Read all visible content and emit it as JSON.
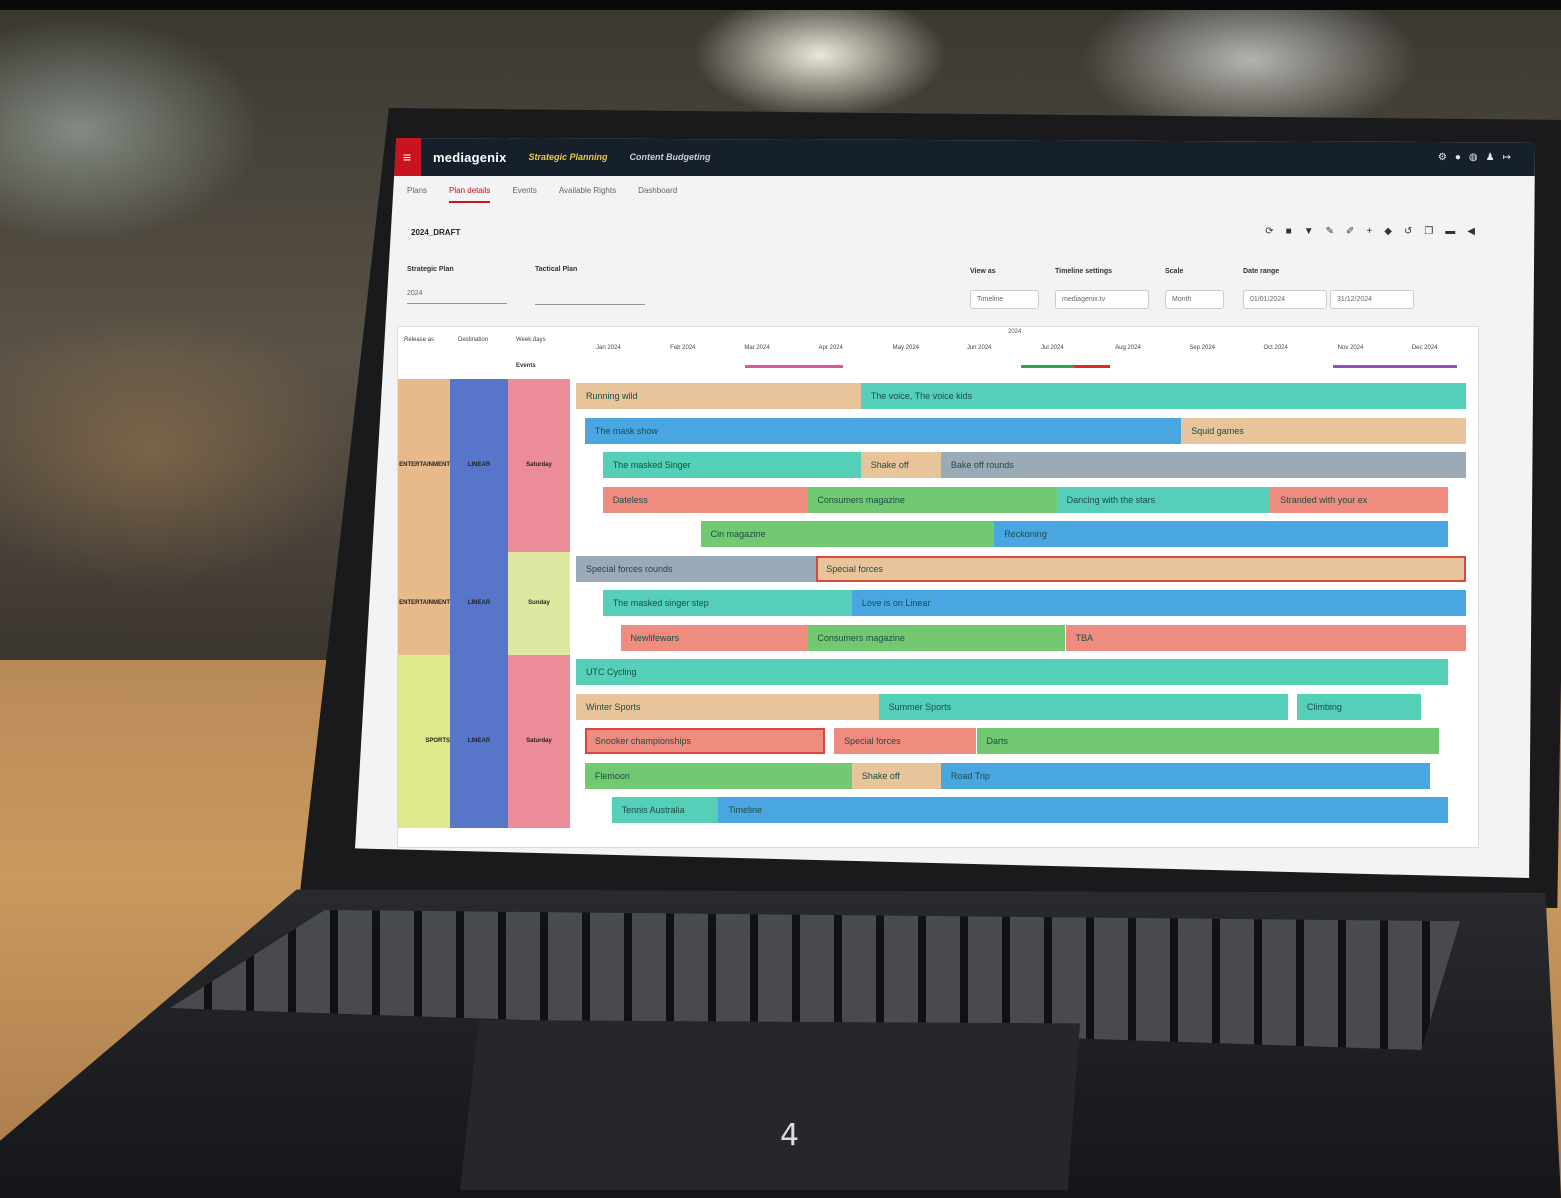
{
  "app": {
    "brand": "mediagenix",
    "nav": [
      "Strategic Planning",
      "Content Budgeting"
    ],
    "active_nav": 0
  },
  "subtabs": [
    "Plans",
    "Plan details",
    "Events",
    "Available Rights",
    "Dashboard"
  ],
  "active_subtab": 1,
  "plan_title": "2024_DRAFT",
  "filters": {
    "strategic_plan_label": "Strategic Plan",
    "strategic_plan_value": "2024",
    "tactical_plan_label": "Tactical Plan",
    "tactical_plan_value": "",
    "view_as_label": "View as",
    "view_as_value": "Timeline",
    "timeline_settings_label": "Timeline settings",
    "timeline_settings_value": "mediagenix.tv",
    "scale_label": "Scale",
    "scale_value": "Month",
    "date_range_label": "Date range",
    "date_from": "01/01/2024",
    "date_to": "31/12/2024"
  },
  "gantt": {
    "columns": [
      "Release as",
      "Destination",
      "Week days"
    ],
    "events_label": "Events",
    "year": "2024",
    "months": [
      "Jan 2024",
      "Feb 2024",
      "Mar 2024",
      "Apr 2024",
      "May 2024",
      "Jun 2024",
      "Jul 2024",
      "Aug 2024",
      "Sep 2024",
      "Oct 2024",
      "Nov 2024",
      "Dec 2024"
    ],
    "groups": [
      {
        "category": "ENTERTAINMENT",
        "destination": "LINEAR",
        "days": "Saturday",
        "rows": 5
      },
      {
        "category": "ENTERTAINMENT",
        "destination": "LINEAR",
        "days": "Sunday",
        "rows": 3
      },
      {
        "category": "SPORTS",
        "destination": "LINEAR",
        "days": "Saturday",
        "rows": 5
      }
    ],
    "bars": [
      {
        "row": 0,
        "label": "Running wild",
        "start": 0.0,
        "end": 0.32,
        "color": "#e8c49a"
      },
      {
        "row": 0,
        "label": "The voice, The voice kids",
        "start": 0.32,
        "end": 1.0,
        "color": "#56cfb8"
      },
      {
        "row": 1,
        "label": "The mask show",
        "start": 0.01,
        "end": 0.68,
        "color": "#4aa6e0"
      },
      {
        "row": 1,
        "label": "Squid games",
        "start": 0.68,
        "end": 1.0,
        "color": "#e8c49a"
      },
      {
        "row": 2,
        "label": "The masked Singer",
        "start": 0.03,
        "end": 0.32,
        "color": "#56cfb8"
      },
      {
        "row": 2,
        "label": "Shake off",
        "start": 0.32,
        "end": 0.41,
        "color": "#e8c49a"
      },
      {
        "row": 2,
        "label": "Bake off rounds",
        "start": 0.41,
        "end": 1.0,
        "color": "#9aaab6"
      },
      {
        "row": 3,
        "label": "Dateless",
        "start": 0.03,
        "end": 0.26,
        "color": "#ef8c80"
      },
      {
        "row": 3,
        "label": "Consumers magazine",
        "start": 0.26,
        "end": 0.54,
        "color": "#72c971"
      },
      {
        "row": 3,
        "label": "Dancing with the stars",
        "start": 0.54,
        "end": 0.78,
        "color": "#56cfb8"
      },
      {
        "row": 3,
        "label": "Stranded with your ex",
        "start": 0.78,
        "end": 0.98,
        "color": "#ef8c80"
      },
      {
        "row": 4,
        "label": "Cin magazine",
        "start": 0.14,
        "end": 0.47,
        "color": "#72c971"
      },
      {
        "row": 4,
        "label": "Reckoning",
        "start": 0.47,
        "end": 0.98,
        "color": "#4aa6e0"
      },
      {
        "row": 5,
        "label": "Special forces rounds",
        "start": 0.0,
        "end": 0.27,
        "color": "#9aaab6"
      },
      {
        "row": 5,
        "label": "Special forces",
        "start": 0.27,
        "end": 1.0,
        "color": "#e8c49a",
        "outlined": true
      },
      {
        "row": 6,
        "label": "The masked singer step",
        "start": 0.03,
        "end": 0.31,
        "color": "#56cfb8"
      },
      {
        "row": 6,
        "label": "Love is on Linear",
        "start": 0.31,
        "end": 1.0,
        "color": "#4aa6e0"
      },
      {
        "row": 7,
        "label": "Newlifewars",
        "start": 0.05,
        "end": 0.26,
        "color": "#ef8c80"
      },
      {
        "row": 7,
        "label": "Consumers magazine",
        "start": 0.26,
        "end": 0.55,
        "color": "#72c971"
      },
      {
        "row": 7,
        "label": "TBA",
        "start": 0.55,
        "end": 1.0,
        "color": "#ef8c80"
      },
      {
        "row": 8,
        "label": "UTC Cycling",
        "start": 0.0,
        "end": 0.98,
        "color": "#56cfb8"
      },
      {
        "row": 9,
        "label": "Winter Sports",
        "start": 0.0,
        "end": 0.34,
        "color": "#e8c49a"
      },
      {
        "row": 9,
        "label": "Summer Sports",
        "start": 0.34,
        "end": 0.8,
        "color": "#56cfb8"
      },
      {
        "row": 9,
        "label": "Climbing",
        "start": 0.81,
        "end": 0.95,
        "color": "#56cfb8"
      },
      {
        "row": 10,
        "label": "Snooker championships",
        "start": 0.01,
        "end": 0.28,
        "color": "#ef8c80",
        "outlined": true
      },
      {
        "row": 10,
        "label": "Special forces",
        "start": 0.29,
        "end": 0.45,
        "color": "#ef8c80"
      },
      {
        "row": 10,
        "label": "Darts",
        "start": 0.45,
        "end": 0.97,
        "color": "#72c971"
      },
      {
        "row": 11,
        "label": "Flemoon",
        "start": 0.01,
        "end": 0.31,
        "color": "#72c971"
      },
      {
        "row": 11,
        "label": "Shake off",
        "start": 0.31,
        "end": 0.41,
        "color": "#e8c49a"
      },
      {
        "row": 11,
        "label": "Road Trip",
        "start": 0.41,
        "end": 0.96,
        "color": "#4aa6e0"
      },
      {
        "row": 12,
        "label": "Tennis Australia",
        "start": 0.04,
        "end": 0.16,
        "color": "#56cfb8"
      },
      {
        "row": 12,
        "label": "Timeline",
        "start": 0.16,
        "end": 0.98,
        "color": "#4aa6e0"
      }
    ],
    "events": [
      {
        "start": 0.19,
        "end": 0.3,
        "color": "#e0559a"
      },
      {
        "start": 0.5,
        "end": 0.56,
        "color": "#2fa44f"
      },
      {
        "start": 0.56,
        "end": 0.6,
        "color": "#e02a2a"
      },
      {
        "start": 0.85,
        "end": 0.99,
        "color": "#9050c8"
      }
    ]
  },
  "page_number": "4"
}
